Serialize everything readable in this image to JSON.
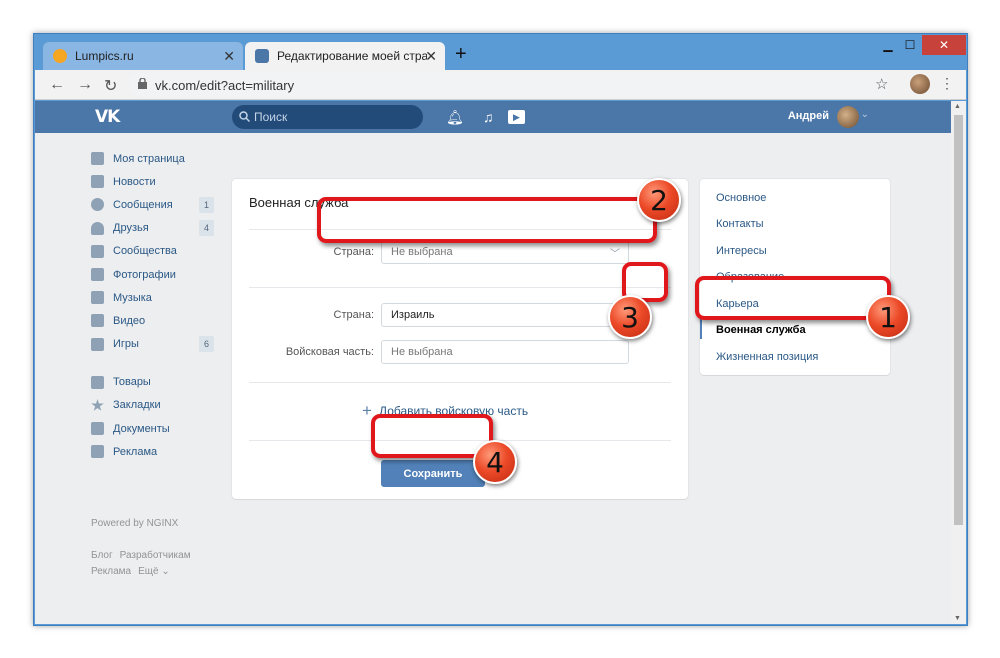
{
  "browser": {
    "tabs": [
      {
        "title": "Lumpics.ru",
        "favicon_color": "#f5a623"
      },
      {
        "title": "Редактирование моей страниц",
        "favicon_color": "#4a76a8"
      }
    ],
    "url": "vk.com/edit?act=military"
  },
  "header": {
    "logo": "VK",
    "search_placeholder": "Поиск",
    "user_name": "Андрей"
  },
  "left_menu": {
    "items": [
      {
        "label": "Моя страница"
      },
      {
        "label": "Новости"
      },
      {
        "label": "Сообщения",
        "badge": "1"
      },
      {
        "label": "Друзья",
        "badge": "4"
      },
      {
        "label": "Сообщества"
      },
      {
        "label": "Фотографии"
      },
      {
        "label": "Музыка"
      },
      {
        "label": "Видео"
      },
      {
        "label": "Игры",
        "badge": "6"
      }
    ],
    "items2": [
      {
        "label": "Товары"
      },
      {
        "label": "Закладки"
      },
      {
        "label": "Документы"
      },
      {
        "label": "Реклама"
      }
    ],
    "powered": "Powered by NGINX",
    "footer": [
      "Блог",
      "Разработчикам",
      "Реклама",
      "Ещё ⌄"
    ]
  },
  "main": {
    "title": "Военная служба",
    "new_country_label": "Страна:",
    "new_country_value": "Не выбрана",
    "country_label": "Страна:",
    "country_value": "Израиль",
    "unit_label": "Войсковая часть:",
    "unit_placeholder": "Не выбрана",
    "add_unit": "Добавить войсковую часть",
    "save": "Сохранить"
  },
  "right_menu": {
    "items": [
      "Основное",
      "Контакты",
      "Интересы",
      "Образование",
      "Карьера",
      "Военная служба",
      "Жизненная позиция"
    ],
    "active_index": 5
  },
  "annotations": [
    "1",
    "2",
    "3",
    "4"
  ],
  "colors": {
    "vk_blue": "#4a76a8",
    "annotation_red": "#e0171b",
    "window_frame": "#5b9bd5"
  }
}
